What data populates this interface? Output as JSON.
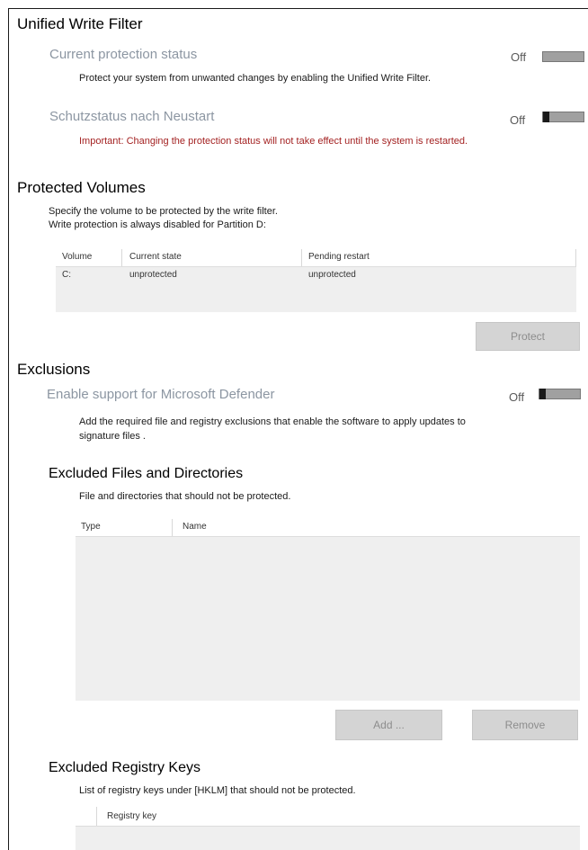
{
  "uwf": {
    "title": "Unified Write Filter",
    "current": {
      "label": "Current protection status",
      "description": "Protect your system from unwanted changes by enabling the Unified Write Filter.",
      "state": "Off"
    },
    "after_restart": {
      "label": "Schutzstatus nach Neustart",
      "warning": "Important: Changing the protection status will not take effect until the system is restarted.",
      "state": "Off"
    }
  },
  "volumes": {
    "title": "Protected Volumes",
    "line1": "Specify the volume to be protected by the write filter.",
    "line2": "Write protection is always disabled for Partition D:",
    "columns": [
      "Volume",
      "Current state",
      "Pending restart"
    ],
    "rows": [
      {
        "volume": "C:",
        "current": "unprotected",
        "pending": "unprotected"
      }
    ],
    "protect_button": "Protect"
  },
  "exclusions": {
    "title": "Exclusions",
    "defender": {
      "label": "Enable support for Microsoft Defender",
      "description": "Add the required file and registry exclusions that enable the software to apply updates to signature files .",
      "state": "Off"
    },
    "files": {
      "title": "Excluded Files and Directories",
      "description": "File and directories that should not be protected.",
      "columns": [
        "Type",
        "Name"
      ],
      "add_button": "Add ...",
      "remove_button": "Remove"
    },
    "registry": {
      "title": "Excluded Registry Keys",
      "description": "List of registry keys under [HKLM] that should not be protected.",
      "columns": [
        "Registry key"
      ]
    }
  }
}
